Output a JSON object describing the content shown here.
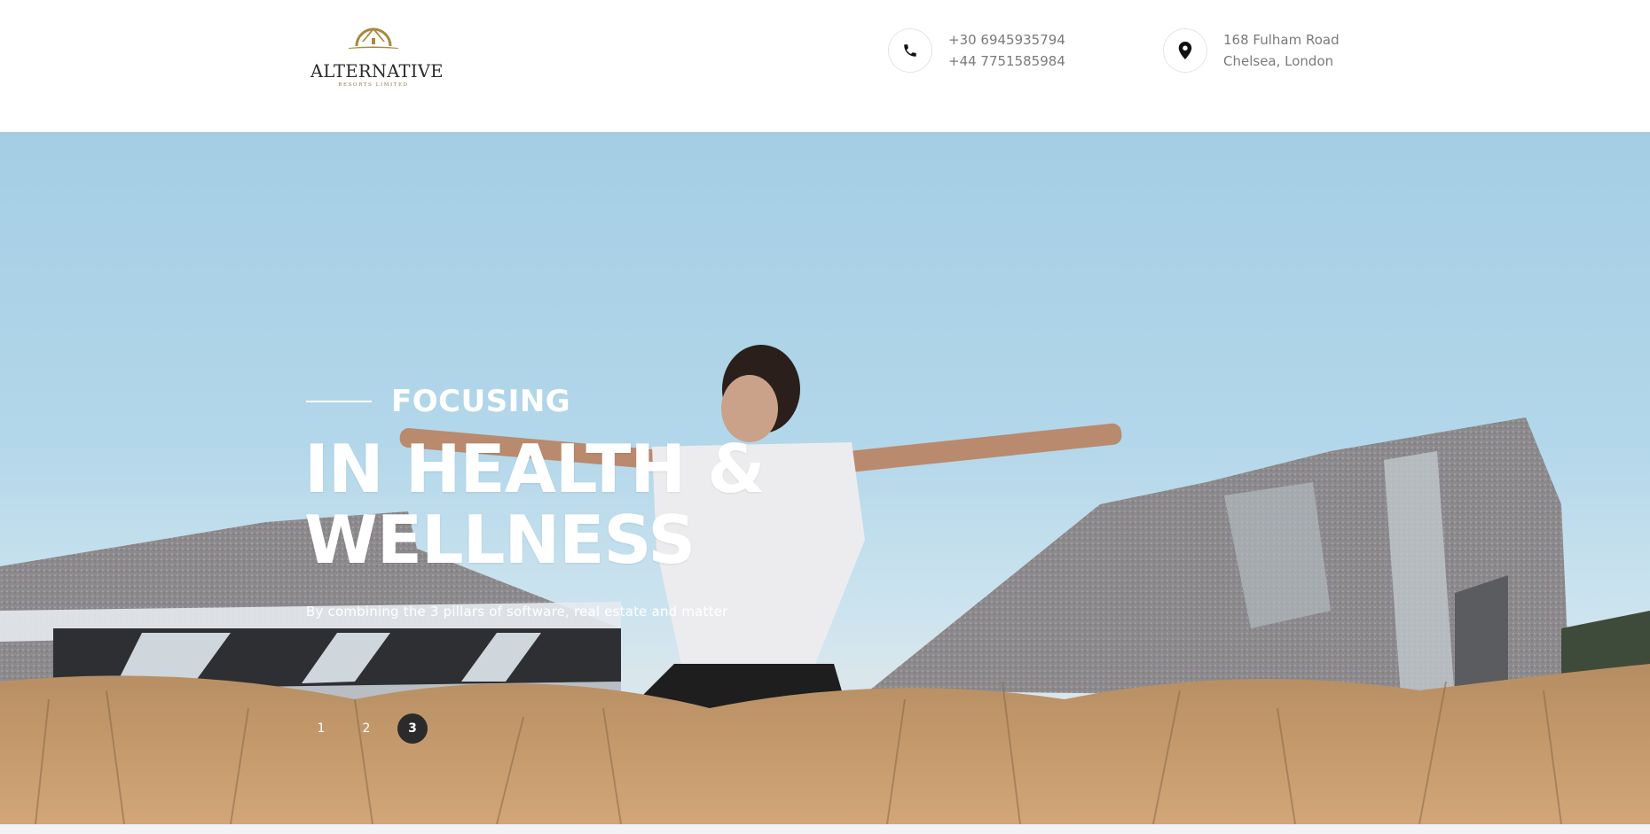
{
  "header": {
    "logo": {
      "name": "ALTERNATIVE",
      "subtitle": "RESORTS LIMITED",
      "accent_color": "#a8893a"
    },
    "phone": {
      "icon": "phone-icon",
      "lines": [
        "+30 6945935794",
        "+44 7751585984"
      ]
    },
    "address": {
      "icon": "map-pin-icon",
      "lines": [
        "168 Fulham Road",
        "Chelsea, London"
      ]
    }
  },
  "hero": {
    "subtitle": "FOCUSING",
    "headline_line1": "IN HEALTH &",
    "headline_line2": "WELLNESS",
    "tagline": "By combining the 3 pillars of software, real estate and matter",
    "slides": [
      "1",
      "2",
      "3"
    ],
    "active_slide": "3"
  }
}
